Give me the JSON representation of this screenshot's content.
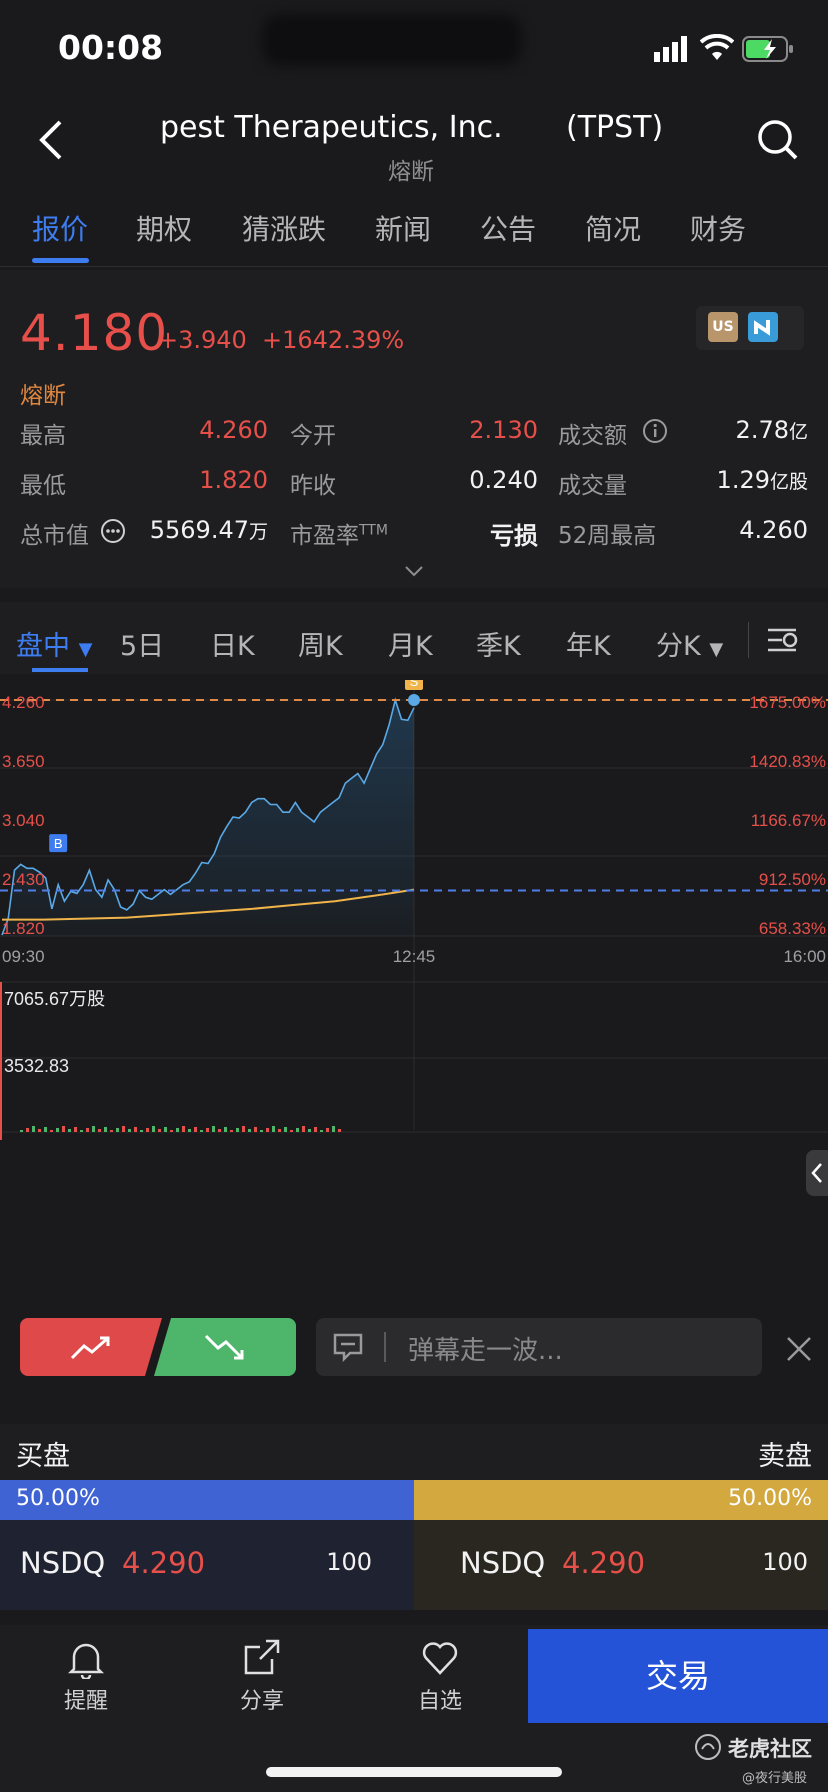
{
  "status": {
    "time": "00:08"
  },
  "header": {
    "title": "pest Therapeutics, Inc.",
    "ticker": "(TPST)",
    "subtitle": "熔断"
  },
  "tabs": [
    "报价",
    "期权",
    "猜涨跌",
    "新闻",
    "公告",
    "简况",
    "财务"
  ],
  "quote": {
    "price": "4.180",
    "change": "+3.940",
    "change_pct": "+1642.39%",
    "status": "熔断",
    "badges": [
      "US",
      "~"
    ],
    "rows": [
      [
        {
          "label": "最高",
          "value": "4.260"
        },
        {
          "label": "今开",
          "value": "2.130"
        },
        {
          "label": "成交额",
          "value": "2.78",
          "unit": "亿"
        }
      ],
      [
        {
          "label": "最低",
          "value": "1.820"
        },
        {
          "label": "昨收",
          "value": "0.240"
        },
        {
          "label": "成交量",
          "value": "1.29",
          "unit": "亿股"
        }
      ],
      [
        {
          "label": "总市值",
          "value": "5569.47",
          "unit": "万"
        },
        {
          "label": "市盈率",
          "sup": "TTM",
          "value": "亏损"
        },
        {
          "label": "52周最高",
          "value": "4.260"
        }
      ]
    ]
  },
  "chart_tabs": [
    "盘中",
    "5日",
    "日K",
    "周K",
    "月K",
    "季K",
    "年K",
    "分K"
  ],
  "chart_data": {
    "type": "line",
    "x_ticks": [
      "09:30",
      "12:45",
      "16:00"
    ],
    "y_ticks_left": [
      "4.260",
      "3.650",
      "3.040",
      "2.430",
      "1.820"
    ],
    "y_ticks_right": [
      "1675.00%",
      "1420.83%",
      "1166.67%",
      "912.50%",
      "658.33%"
    ],
    "ylim": [
      1.82,
      4.26
    ],
    "prev_close_line": 2.29,
    "high_line": 4.26,
    "price_series": [
      [
        0,
        1.83
      ],
      [
        3,
        2.0
      ],
      [
        6,
        2.5
      ],
      [
        9,
        2.56
      ],
      [
        12,
        2.52
      ],
      [
        15,
        2.52
      ],
      [
        18,
        2.48
      ],
      [
        21,
        2.42
      ],
      [
        24,
        2.1
      ],
      [
        27,
        2.35
      ],
      [
        30,
        2.18
      ],
      [
        33,
        2.28
      ],
      [
        36,
        2.26
      ],
      [
        39,
        2.35
      ],
      [
        42,
        2.5
      ],
      [
        45,
        2.3
      ],
      [
        48,
        2.22
      ],
      [
        51,
        2.4
      ],
      [
        54,
        2.3
      ],
      [
        57,
        2.12
      ],
      [
        60,
        2.09
      ],
      [
        63,
        2.15
      ],
      [
        66,
        2.29
      ],
      [
        69,
        2.22
      ],
      [
        72,
        2.2
      ],
      [
        75,
        2.25
      ],
      [
        78,
        2.3
      ],
      [
        81,
        2.25
      ],
      [
        84,
        2.3
      ],
      [
        87,
        2.35
      ],
      [
        90,
        2.38
      ],
      [
        93,
        2.47
      ],
      [
        96,
        2.58
      ],
      [
        99,
        2.57
      ],
      [
        102,
        2.67
      ],
      [
        105,
        2.84
      ],
      [
        108,
        2.95
      ],
      [
        111,
        3.05
      ],
      [
        114,
        3.04
      ],
      [
        117,
        3.1
      ],
      [
        120,
        3.2
      ],
      [
        123,
        3.24
      ],
      [
        126,
        3.24
      ],
      [
        129,
        3.18
      ],
      [
        132,
        3.18
      ],
      [
        135,
        3.1
      ],
      [
        138,
        3.1
      ],
      [
        141,
        3.2
      ],
      [
        144,
        3.1
      ],
      [
        147,
        3.05
      ],
      [
        150,
        3.0
      ],
      [
        153,
        3.1
      ],
      [
        156,
        3.15
      ],
      [
        159,
        3.2
      ],
      [
        162,
        3.25
      ],
      [
        165,
        3.4
      ],
      [
        168,
        3.45
      ],
      [
        171,
        3.5
      ],
      [
        174,
        3.4
      ],
      [
        177,
        3.55
      ],
      [
        180,
        3.7
      ],
      [
        183,
        3.8
      ],
      [
        186,
        4.0
      ],
      [
        189,
        4.26
      ],
      [
        192,
        4.06
      ],
      [
        195,
        4.05
      ],
      [
        198,
        4.18
      ]
    ],
    "avg_series": [
      [
        0,
        1.99
      ],
      [
        20,
        1.99
      ],
      [
        40,
        2.0
      ],
      [
        60,
        2.01
      ],
      [
        80,
        2.04
      ],
      [
        100,
        2.07
      ],
      [
        120,
        2.1
      ],
      [
        140,
        2.14
      ],
      [
        160,
        2.18
      ],
      [
        180,
        2.24
      ],
      [
        198,
        2.3
      ]
    ],
    "markers": [
      {
        "label": "B",
        "x": 27,
        "y": 2.46
      },
      {
        "label": "S",
        "x": 198,
        "y": 4.26
      }
    ],
    "volume_ticks": [
      "7065.67万股",
      "3532.83"
    ]
  },
  "controls": {
    "danmaku_placeholder": "弹幕走一波..."
  },
  "orderbook": {
    "buy_label": "买盘",
    "sell_label": "卖盘",
    "buy_pct": "50.00%",
    "sell_pct": "50.00%",
    "buy": {
      "exchange": "NSDQ",
      "price": "4.290",
      "size": "100"
    },
    "sell": {
      "exchange": "NSDQ",
      "price": "4.290",
      "size": "100"
    }
  },
  "bottom_nav": {
    "items": [
      {
        "label": "提醒",
        "icon": "bell-icon"
      },
      {
        "label": "分享",
        "icon": "share-icon"
      },
      {
        "label": "自选",
        "icon": "heart-icon"
      }
    ],
    "trade": "交易",
    "brand": "老虎社区",
    "handle": "@夜行美股"
  },
  "colors": {
    "accent": "#3d7df0",
    "up": "#e7504a",
    "down": "#4fba6f",
    "gold": "#d5aa42"
  }
}
